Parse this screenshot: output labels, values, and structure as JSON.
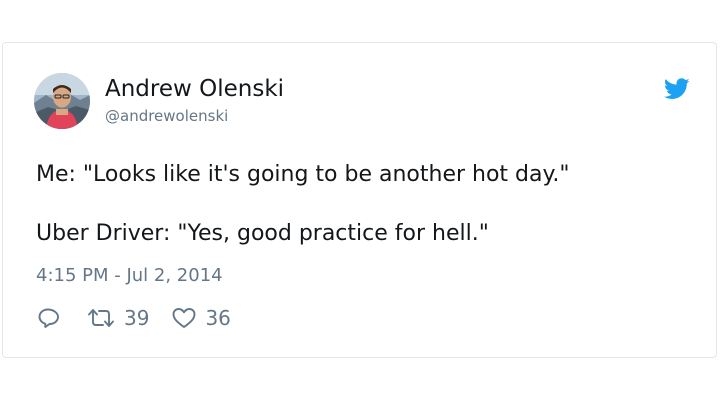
{
  "tweet": {
    "author": {
      "display_name": "Andrew Olenski",
      "handle": "@andrewolenski",
      "avatar_icon": "avatar-photo"
    },
    "platform_icon": "twitter-bird-icon",
    "text_lines": [
      "Me: \"Looks like it's going to be another hot day.\"",
      "Uber Driver: \"Yes, good practice for hell.\""
    ],
    "timestamp": "4:15 PM - Jul 2, 2014",
    "actions": {
      "reply_icon": "reply-icon",
      "retweet_icon": "retweet-icon",
      "retweet_count": "39",
      "like_icon": "heart-icon",
      "like_count": "36"
    }
  },
  "colors": {
    "brand_blue": "#1da1f2",
    "text_primary": "#14171a",
    "text_secondary": "#657786",
    "border": "#e1e8ed"
  }
}
